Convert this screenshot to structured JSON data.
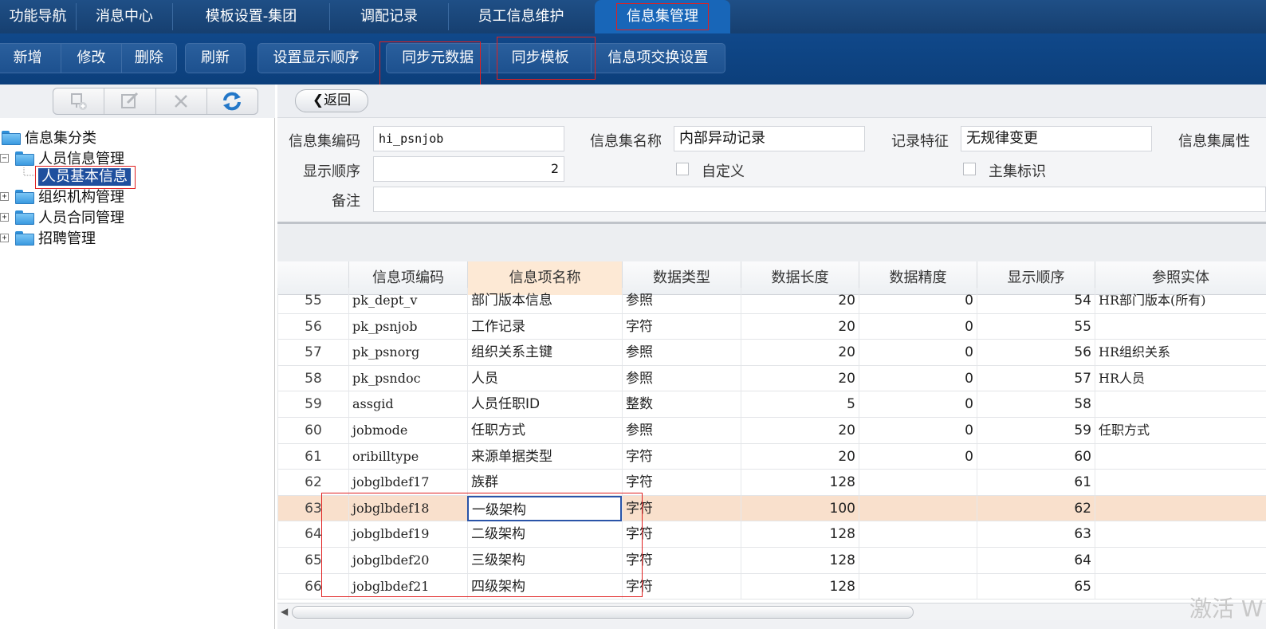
{
  "top_tabs": [
    "功能导航",
    "消息中心",
    "模板设置-集团",
    "调配记录",
    "员工信息维护",
    "信息集管理"
  ],
  "toolbar": {
    "add": "新增",
    "edit": "修改",
    "delete": "删除",
    "refresh": "刷新",
    "display_order": "设置显示顺序",
    "sync_metadata": "同步元数据",
    "sync_template": "同步模板",
    "exchange_settings": "信息项交换设置"
  },
  "tree": {
    "root": "信息集分类",
    "items": [
      "人员信息管理",
      "人员基本信息",
      "组织机构管理",
      "人员合同管理",
      "招聘管理"
    ]
  },
  "back_label": "返回",
  "form": {
    "code_label": "信息集编码",
    "code_value": "hi_psnjob",
    "name_label": "信息集名称",
    "name_value": "内部异动记录",
    "record_label": "记录特征",
    "record_value": "无规律变更",
    "attr_label": "信息集属性",
    "order_label": "显示顺序",
    "order_value": "2",
    "custom_label": "自定义",
    "main_label": "主集标识",
    "remark_label": "备注",
    "remark_value": ""
  },
  "grid": {
    "columns": [
      "信息项编码",
      "信息项名称",
      "数据类型",
      "数据长度",
      "数据精度",
      "显示顺序",
      "参照实体"
    ],
    "rows": [
      [
        "55",
        "pk_dept_v",
        "部门版本信息",
        "参照",
        "20",
        "0",
        "54",
        "HR部门版本(所有)"
      ],
      [
        "56",
        "pk_psnjob",
        "工作记录",
        "字符",
        "20",
        "0",
        "55",
        ""
      ],
      [
        "57",
        "pk_psnorg",
        "组织关系主键",
        "参照",
        "20",
        "0",
        "56",
        "HR组织关系"
      ],
      [
        "58",
        "pk_psndoc",
        "人员",
        "参照",
        "20",
        "0",
        "57",
        "HR人员"
      ],
      [
        "59",
        "assgid",
        "人员任职ID",
        "整数",
        "5",
        "0",
        "58",
        ""
      ],
      [
        "60",
        "jobmode",
        "任职方式",
        "参照",
        "20",
        "0",
        "59",
        "任职方式"
      ],
      [
        "61",
        "oribilltype",
        "来源单据类型",
        "字符",
        "20",
        "0",
        "60",
        ""
      ],
      [
        "62",
        "jobglbdef17",
        "族群",
        "字符",
        "128",
        "",
        "61",
        ""
      ],
      [
        "63",
        "jobglbdef18",
        "一级架构",
        "字符",
        "100",
        "",
        "62",
        ""
      ],
      [
        "64",
        "jobglbdef19",
        "二级架构",
        "字符",
        "128",
        "",
        "63",
        ""
      ],
      [
        "65",
        "jobglbdef20",
        "三级架构",
        "字符",
        "128",
        "",
        "64",
        ""
      ],
      [
        "66",
        "jobglbdef21",
        "四级架构",
        "字符",
        "128",
        "",
        "65",
        ""
      ]
    ]
  },
  "watermark": "激活 W"
}
